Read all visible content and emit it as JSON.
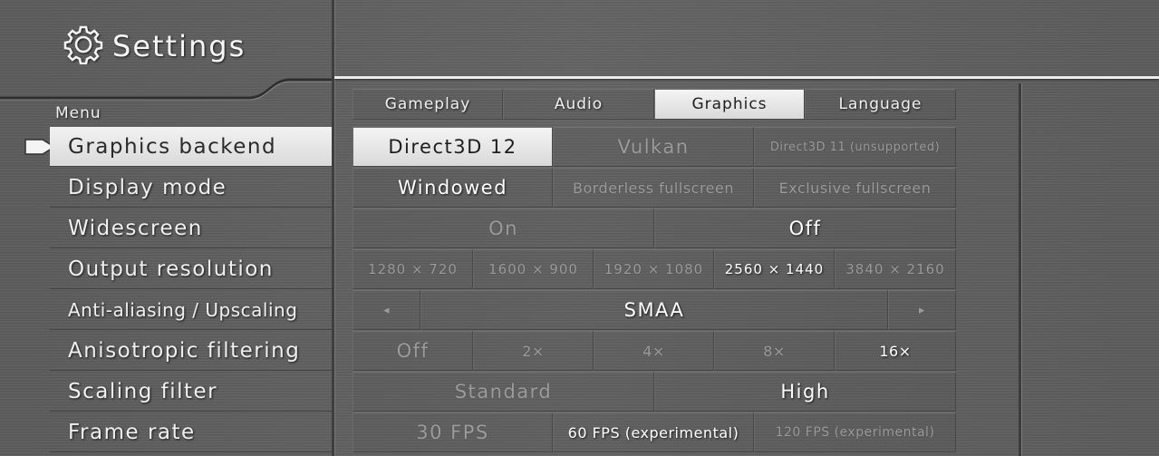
{
  "title": "Settings",
  "menu_label": "Menu",
  "menu": [
    {
      "label": "Graphics backend",
      "active": true
    },
    {
      "label": "Display mode"
    },
    {
      "label": "Widescreen"
    },
    {
      "label": "Output resolution"
    },
    {
      "label": "Anti-aliasing / Upscaling"
    },
    {
      "label": "Anisotropic filtering"
    },
    {
      "label": "Scaling filter"
    },
    {
      "label": "Frame rate"
    }
  ],
  "tabs": [
    {
      "label": "Gameplay"
    },
    {
      "label": "Audio"
    },
    {
      "label": "Graphics",
      "active": true
    },
    {
      "label": "Language"
    }
  ],
  "options": {
    "backend": [
      "Direct3D 12",
      "Vulkan",
      "Direct3D 11 (unsupported)"
    ],
    "display_mode": [
      "Windowed",
      "Borderless fullscreen",
      "Exclusive fullscreen"
    ],
    "widescreen": [
      "On",
      "Off"
    ],
    "resolution": [
      "1280 × 720",
      "1600 × 900",
      "1920 × 1080",
      "2560 × 1440",
      "3840 × 2160"
    ],
    "aa": {
      "prev": "◂",
      "value": "SMAA",
      "next": "▸"
    },
    "aniso": [
      "Off",
      "2×",
      "4×",
      "8×",
      "16×"
    ],
    "scaling": [
      "Standard",
      "High"
    ],
    "framerate": [
      "30 FPS",
      "60 FPS (experimental)",
      "120 FPS (experimental)"
    ]
  },
  "colors": {
    "accent_selected": "#e6e6e6",
    "background": "#5c5c5c"
  }
}
